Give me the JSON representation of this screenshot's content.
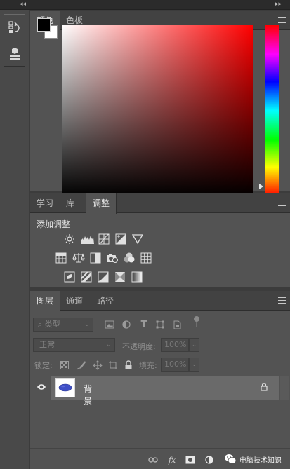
{
  "color_panel": {
    "tabs": [
      {
        "label": "颜色",
        "active": true
      },
      {
        "label": "色板",
        "active": false
      }
    ],
    "foreground": "#000000",
    "background": "#ffffff",
    "hue": "#ff0000"
  },
  "adjust_panel": {
    "tabs": [
      {
        "label": "学习",
        "active": false
      },
      {
        "label": "库",
        "active": false
      },
      {
        "label": "调整",
        "active": true
      }
    ],
    "title": "添加调整",
    "icons_row1": [
      "brightness-contrast-icon",
      "levels-icon",
      "curves-icon",
      "exposure-icon",
      "vibrance-icon"
    ],
    "icons_row2": [
      "hue-saturation-icon",
      "color-balance-icon",
      "black-white-icon",
      "photo-filter-icon",
      "channel-mixer-icon",
      "color-lookup-icon"
    ],
    "icons_row3": [
      "invert-icon",
      "posterize-icon",
      "threshold-icon",
      "selective-color-icon",
      "gradient-map-icon"
    ]
  },
  "layers_panel": {
    "tabs": [
      {
        "label": "图层",
        "active": true
      },
      {
        "label": "通道",
        "active": false
      },
      {
        "label": "路径",
        "active": false
      }
    ],
    "filter_placeholder": "类型",
    "blend_mode": "正常",
    "opacity_label": "不透明度:",
    "opacity_value": "100%",
    "lock_label": "锁定:",
    "fill_label": "填充:",
    "fill_value": "100%",
    "layers": [
      {
        "name": "背景",
        "visible": true,
        "locked": true
      }
    ]
  },
  "watermark": {
    "text": "电脑技术知识"
  }
}
